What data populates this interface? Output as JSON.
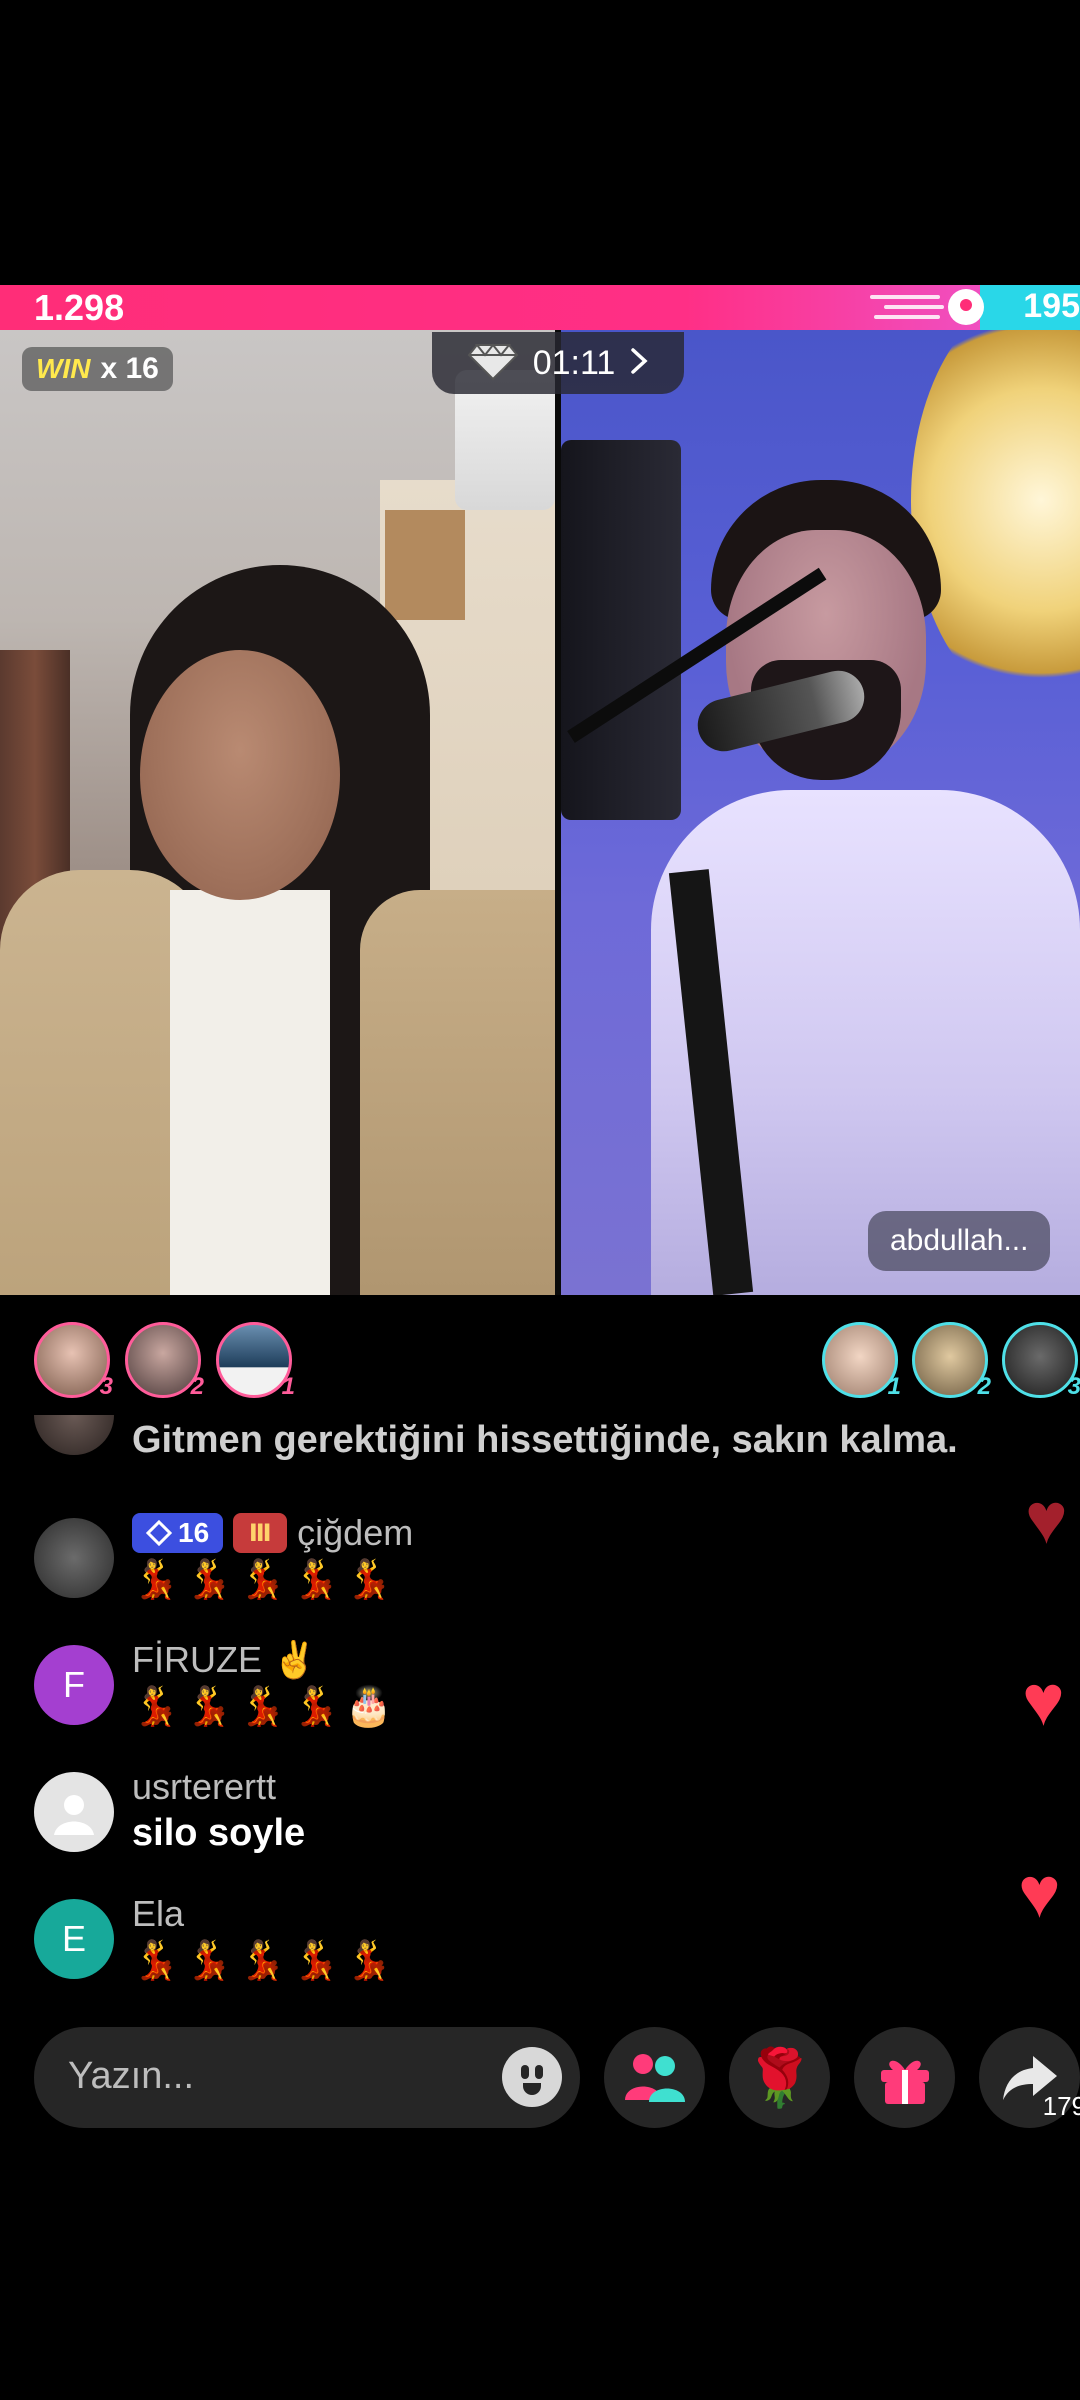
{
  "battle": {
    "left_score": "1.298",
    "right_score": "195",
    "win_label": "WIN",
    "win_multiplier": "x 16",
    "timer": "01:11",
    "timer_chevron": ">",
    "opponent_name": "abdullah..."
  },
  "supporters": {
    "left": [
      {
        "rank": "3"
      },
      {
        "rank": "2"
      },
      {
        "rank": "1"
      }
    ],
    "right": [
      {
        "rank": "1"
      },
      {
        "rank": "2"
      },
      {
        "rank": "3"
      }
    ]
  },
  "comments": [
    {
      "name": "",
      "text": "Gitmen gerektiğini hissettiğinde, sakın kalma.",
      "emoji": ""
    },
    {
      "name": "çiğdem",
      "level": "16",
      "text": "",
      "emoji": "💃💃💃💃💃"
    },
    {
      "name": "FİRUZE ✌️",
      "avatar_letter": "F",
      "text": "",
      "emoji": "💃💃💃💃🎂"
    },
    {
      "name": "usrterertt",
      "text": "silo soyle",
      "emoji": ""
    },
    {
      "name": "Ela",
      "avatar_letter": "E",
      "text": "",
      "emoji": "💃💃💃💃💃"
    }
  ],
  "composer": {
    "placeholder": "Yazın...",
    "share_count": "179"
  },
  "icons": {
    "diamond": "diamond-icon",
    "chevron": "chevron-right-icon",
    "emoji": "emoji-icon",
    "collab": "collab-icon",
    "rose": "rose-gift-icon",
    "gift": "gift-icon",
    "share": "share-icon",
    "heart": "heart-icon"
  },
  "colors": {
    "left_team": "#ff2d78",
    "right_team": "#29d7e8",
    "win_text": "#ffe94d",
    "level_badge": "#3c4fe0"
  }
}
